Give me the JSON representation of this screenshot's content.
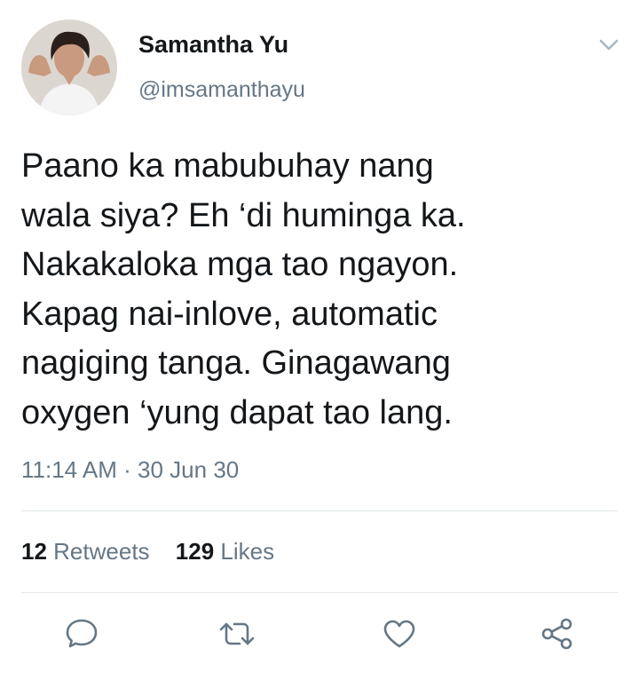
{
  "tweet": {
    "author": {
      "display_name": "Samantha Yu",
      "handle": "@imsamanthayu",
      "avatar_icon": "profile-photo"
    },
    "text_lines": [
      "Paano ka mabubuhay nang",
      "wala siya? Eh ‘di huminga ka.",
      "Nakakaloka mga tao ngayon.",
      "Kapag nai-inlove, automatic",
      "nagiging tanga. Ginagawang",
      "oxygen ‘yung dapat tao lang."
    ],
    "timestamp": "11:14 AM · 30 Jun 30",
    "stats": {
      "retweets_count": "12",
      "retweets_label": "Retweets",
      "likes_count": "129",
      "likes_label": "Likes"
    },
    "actions": [
      {
        "name": "reply",
        "icon": "speech-bubble-icon"
      },
      {
        "name": "retweet",
        "icon": "retweet-arrows-icon"
      },
      {
        "name": "like",
        "icon": "heart-icon"
      },
      {
        "name": "share",
        "icon": "share-nodes-icon"
      }
    ]
  },
  "colors": {
    "primary_text": "#14171a",
    "secondary_text": "#657786",
    "divider": "#e1e8ed",
    "icon": "#657786"
  }
}
